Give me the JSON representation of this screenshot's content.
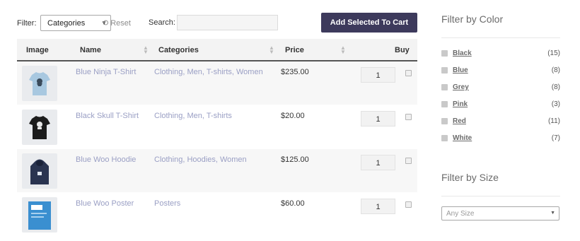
{
  "toolbar": {
    "filter_label": "Filter:",
    "category_select": "Categories",
    "reset_label": "Reset",
    "search_label": "Search:",
    "search_value": "",
    "add_button": "Add Selected To Cart"
  },
  "table": {
    "headers": {
      "image": "Image",
      "name": "Name",
      "categories": "Categories",
      "price": "Price",
      "buy": "Buy"
    },
    "rows": [
      {
        "name": "Blue Ninja T-Shirt",
        "categories": [
          "Clothing",
          "Men",
          "T-shirts",
          "Women"
        ],
        "price": "$235.00",
        "qty": "1",
        "thumb": "tshirt-blue-icon"
      },
      {
        "name": "Black Skull T-Shirt",
        "categories": [
          "Clothing",
          "Men",
          "T-shirts"
        ],
        "price": "$20.00",
        "qty": "1",
        "thumb": "tshirt-black-icon"
      },
      {
        "name": "Blue Woo Hoodie",
        "categories": [
          "Clothing",
          "Hoodies",
          "Women"
        ],
        "price": "$125.00",
        "qty": "1",
        "thumb": "hoodie-icon"
      },
      {
        "name": "Blue Woo Poster",
        "categories": [
          "Posters"
        ],
        "price": "$60.00",
        "qty": "1",
        "thumb": "poster-icon"
      }
    ]
  },
  "sidebar": {
    "color_title": "Filter by Color",
    "colors": [
      {
        "label": "Black",
        "count": "(15)"
      },
      {
        "label": "Blue",
        "count": "(8)"
      },
      {
        "label": "Grey",
        "count": "(8)"
      },
      {
        "label": "Pink",
        "count": "(3)"
      },
      {
        "label": "Red",
        "count": "(11)"
      },
      {
        "label": "White",
        "count": "(7)"
      }
    ],
    "size_title": "Filter by Size",
    "size_select": "Any Size"
  },
  "colors": {
    "accent_button": "#3d3a5c",
    "link": "#9a9fc4"
  }
}
